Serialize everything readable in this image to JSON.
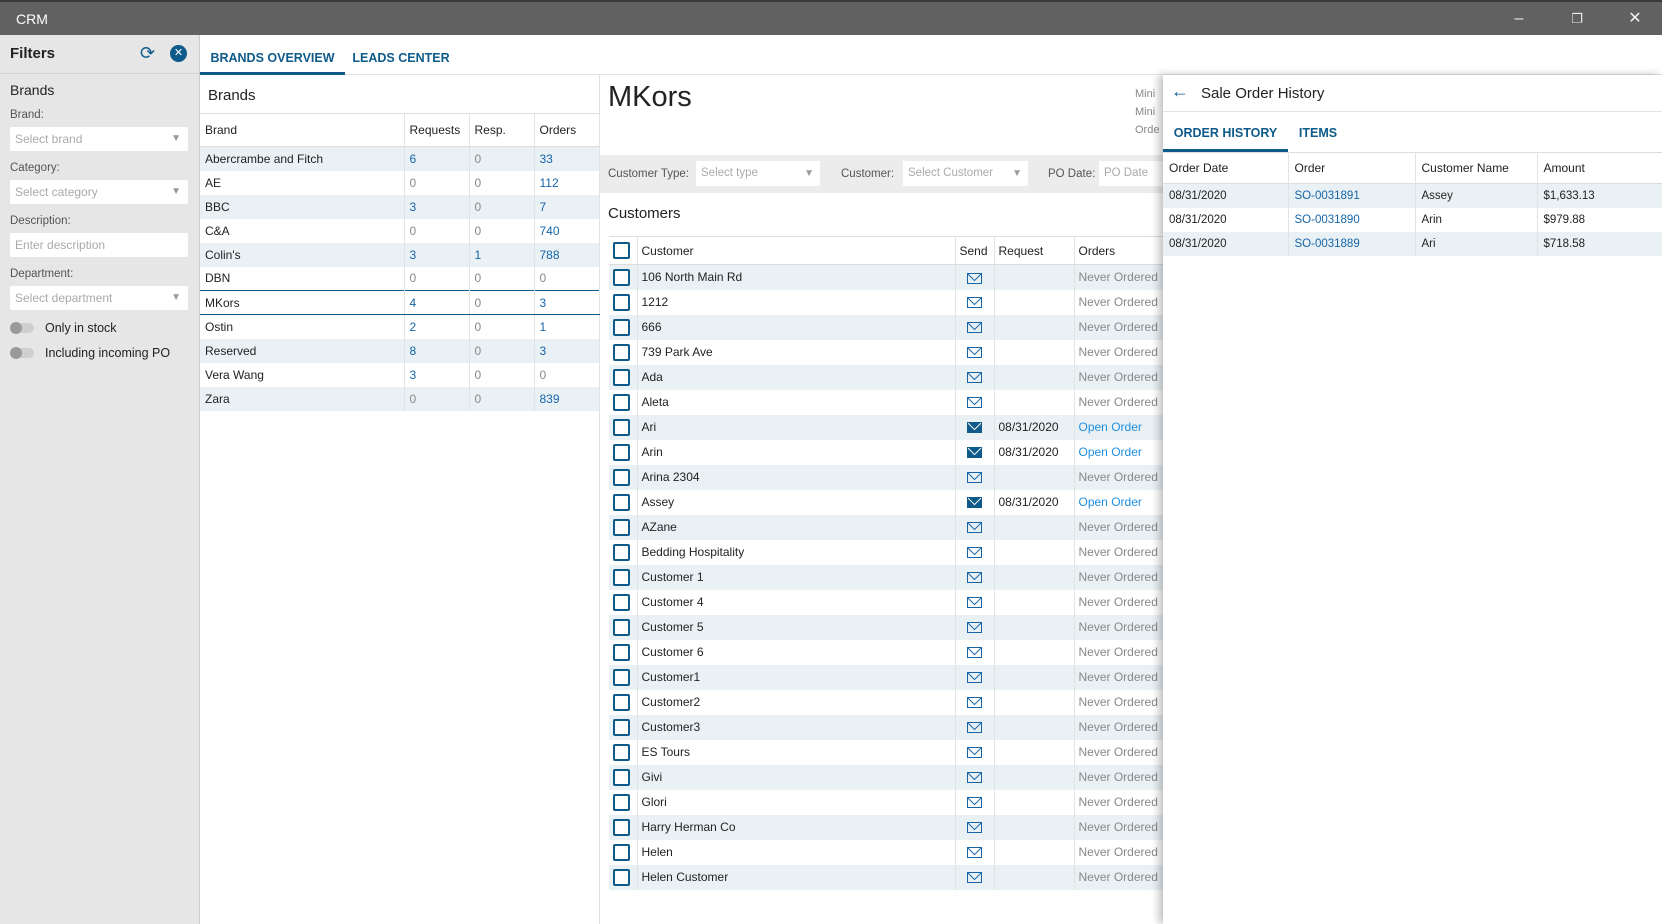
{
  "app": {
    "title": "CRM"
  },
  "filters": {
    "title": "Filters",
    "section": "Brands",
    "brand_label": "Brand:",
    "brand_placeholder": "Select brand",
    "category_label": "Category:",
    "category_placeholder": "Select category",
    "description_label": "Description:",
    "description_placeholder": "Enter description",
    "department_label": "Department:",
    "department_placeholder": "Select department",
    "toggle_stock": "Only in stock",
    "toggle_po": "Including incoming PO"
  },
  "tabs": [
    "BRANDS OVERVIEW",
    "LEADS CENTER"
  ],
  "brands": {
    "title": "Brands",
    "columns": [
      "Brand",
      "Requests",
      "Resp.",
      "Orders"
    ],
    "rows": [
      [
        "Abercrambe and Fitch",
        "6",
        "0",
        "33"
      ],
      [
        "AE",
        "0",
        "0",
        "112"
      ],
      [
        "BBC",
        "3",
        "0",
        "7"
      ],
      [
        "C&A",
        "0",
        "0",
        "740"
      ],
      [
        "Colin's",
        "3",
        "1",
        "788"
      ],
      [
        "DBN",
        "0",
        "0",
        "0"
      ],
      [
        "MKors",
        "4",
        "0",
        "3"
      ],
      [
        "Ostin",
        "2",
        "0",
        "1"
      ],
      [
        "Reserved",
        "8",
        "0",
        "3"
      ],
      [
        "Vera Wang",
        "3",
        "0",
        "0"
      ],
      [
        "Zara",
        "0",
        "0",
        "839"
      ]
    ],
    "selected": "MKors"
  },
  "detail": {
    "title": "MKors",
    "info_labels": [
      "Mini",
      "Mini",
      "Orde"
    ],
    "customer_type_label": "Customer Type:",
    "customer_type_placeholder": "Select type",
    "customer_label": "Customer:",
    "customer_placeholder": "Select Customer",
    "po_date_label": "PO Date:",
    "po_date_placeholder": "PO Date",
    "customers_title": "Customers",
    "columns": [
      "Customer",
      "Send",
      "Request",
      "Orders"
    ],
    "customers": [
      [
        "106 North Main Rd",
        "",
        "Never Ordered"
      ],
      [
        "1212",
        "",
        "Never Ordered"
      ],
      [
        "666",
        "",
        "Never Ordered"
      ],
      [
        "739 Park Ave",
        "",
        "Never Ordered"
      ],
      [
        "Ada",
        "",
        "Never Ordered"
      ],
      [
        "Aleta",
        "",
        "Never Ordered"
      ],
      [
        "Ari",
        "08/31/2020",
        "Open Order"
      ],
      [
        "Arin",
        "08/31/2020",
        "Open Order"
      ],
      [
        "Arina 2304",
        "",
        "Never Ordered"
      ],
      [
        "Assey",
        "08/31/2020",
        "Open Order"
      ],
      [
        "AZane",
        "",
        "Never Ordered"
      ],
      [
        "Bedding Hospitality",
        "",
        "Never Ordered"
      ],
      [
        "Customer 1",
        "",
        "Never Ordered"
      ],
      [
        "Customer 4",
        "",
        "Never Ordered"
      ],
      [
        "Customer 5",
        "",
        "Never Ordered"
      ],
      [
        "Customer 6",
        "",
        "Never Ordered"
      ],
      [
        "Customer1",
        "",
        "Never Ordered"
      ],
      [
        "Customer2",
        "",
        "Never Ordered"
      ],
      [
        "Customer3",
        "",
        "Never Ordered"
      ],
      [
        "ES Tours",
        "",
        "Never Ordered"
      ],
      [
        "Givi",
        "",
        "Never Ordered"
      ],
      [
        "Glori",
        "",
        "Never Ordered"
      ],
      [
        "Harry Herman Co",
        "",
        "Never Ordered"
      ],
      [
        "Helen",
        "",
        "Never Ordered"
      ],
      [
        "Helen Customer",
        "",
        "Never Ordered"
      ]
    ]
  },
  "sale_order": {
    "title": "Sale Order History",
    "tabs": [
      "ORDER HISTORY",
      "ITEMS"
    ],
    "columns": [
      "Order Date",
      "Order",
      "Customer Name",
      "Amount"
    ],
    "rows": [
      [
        "08/31/2020",
        "SO-0031891",
        "Assey",
        "$1,633.13"
      ],
      [
        "08/31/2020",
        "SO-0031890",
        "Arin",
        "$979.88"
      ],
      [
        "08/31/2020",
        "SO-0031889",
        "Ari",
        "$718.58"
      ]
    ]
  },
  "colors": {
    "accent": "#0e5a8a",
    "titlebar": "#616161",
    "stripe": "#eaf1f5",
    "link": "#1e8fe0"
  }
}
